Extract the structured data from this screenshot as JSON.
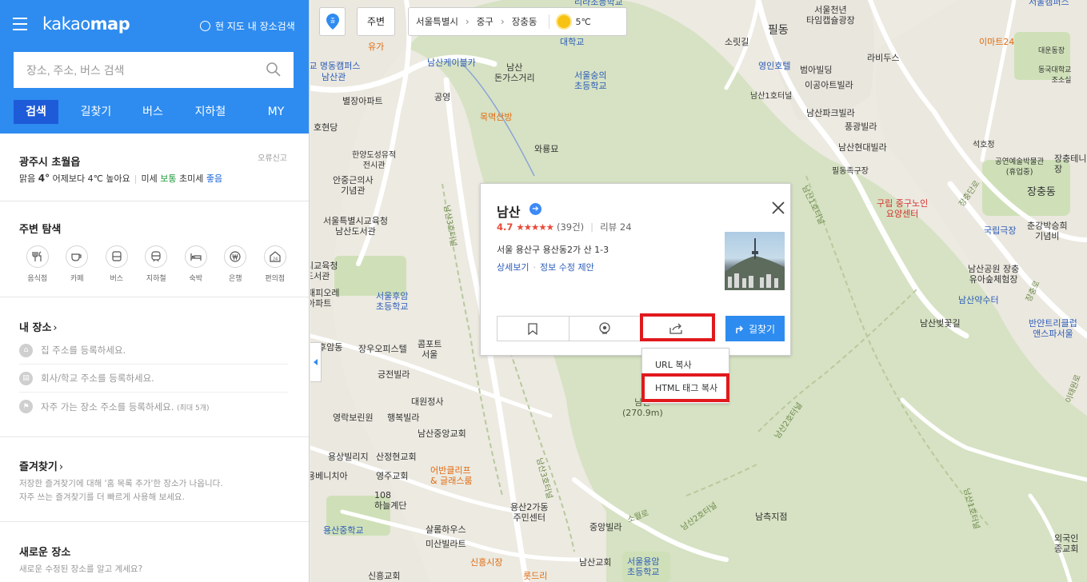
{
  "app": {
    "logo_light": "kakao",
    "logo_bold": "map",
    "here_search": "현 지도 내 장소검색"
  },
  "search": {
    "placeholder": "장소, 주소, 버스 검색"
  },
  "tabs": [
    "검색",
    "길찾기",
    "버스",
    "지하철",
    "MY"
  ],
  "weather": {
    "city": "광주시 초월읍",
    "report": "오류신고",
    "sky": "맑음",
    "temp": "4°",
    "compare": "어제보다 4℃ 높아요",
    "dust_label": "미세",
    "dust_value": "보통",
    "ultra_label": "초미세",
    "ultra_value": "좋음"
  },
  "explore": {
    "title": "주변 탐색",
    "categories": [
      "음식점",
      "카페",
      "버스",
      "지하철",
      "숙박",
      "은행",
      "편의점"
    ]
  },
  "myplace": {
    "title": "내 장소",
    "home": "집 주소를 등록하세요.",
    "work": "회사/학교 주소를 등록하세요.",
    "frequent": "자주 가는 장소 주소를 등록하세요.",
    "frequent_note": "(최대 5개)"
  },
  "favorites": {
    "title": "즐겨찾기",
    "desc1": "저장한 즐겨찾기에 대해 '홈 목록 추가'한 장소가 나옵니다.",
    "desc2": "자주 쓰는 즐겨찾기를 더 빠르게 사용해 보세요."
  },
  "newplace": {
    "title": "새로운 장소",
    "desc": "새로운 수정된 장소를 알고 계세요?"
  },
  "topbar": {
    "pin_label": "출",
    "around": "주변",
    "crumbs": [
      "서울특별시",
      "중구",
      "장충동"
    ],
    "temp": "5℃"
  },
  "card": {
    "title": "남산",
    "rating": "4.7",
    "stars": "★★★★★",
    "count": "(39건)",
    "reviews": "리뷰 24",
    "address": "서울 용산구 용산동2가 산 1-3",
    "detail_link": "상세보기",
    "edit_link": "정보 수정 제안",
    "route": "길찾기"
  },
  "share_menu": {
    "url": "URL 복사",
    "html": "HTML 태그 복사"
  },
  "map_labels": [
    "대학교 명동캠퍼스",
    "남산관",
    "유가",
    "남산케이블카",
    "별장아파트",
    "공영",
    "남산\n돈가스거리",
    "대학교",
    "리라초등학교",
    "서울숭의\n초등학교",
    "목멱산방",
    "와룡묘",
    "호현당",
    "한양도성유적\n전시관",
    "안중근의사\n기념관",
    "서울특별시교육청\n남산도서관",
    "시교육청\n도서관",
    "서울후암\n초등학교",
    "패피오레\n아파트",
    "후암동",
    "장우오피스텔",
    "콤포트\n서울",
    "긍전빌라",
    "대원정사",
    "영락보린원",
    "행복빌라",
    "남산중앙교회",
    "용상빌리지",
    "산정현교회",
    "어반클리프\n& 글래스룸",
    "용베니치아",
    "영주교회",
    "108\n하늘계단",
    "용산2가동\n주민센터",
    "용산중학교",
    "살롬하우스",
    "미산빌라트",
    "중앙빌라",
    "서울용암\n초등학교",
    "신흥시장",
    "신흥교회",
    "롯드리",
    "남산교회",
    "남산\n(270.9m)",
    "필동",
    "소릿길",
    "서울천년\n타임캡슐광장",
    "영인호텔",
    "범아빌딩",
    "라비두스",
    "남산1호터널",
    "이공아트빌라",
    "남산파크빌라",
    "풍광빌라",
    "남산현대빌라",
    "필동족구장",
    "구립 중구노인\n요양센터",
    "서울캠퍼스",
    "이마트24",
    "대운동장",
    "동국대학교\n조소실",
    "석호정",
    "공연예술박물관\n(휴업중)",
    "장충테니스\n장",
    "장충동",
    "국립극장",
    "춘강박승희\n기념비",
    "남산공원 장충\n유아숲체험장",
    "남산약수터",
    "남산벚꽃길",
    "반얀트리클럽\n앤스파서울",
    "남측지점",
    "외국인\n종교회",
    "이태원로",
    "남산3호터널",
    "남산3호터널",
    "남산1호터널",
    "남산2호터널",
    "남산2호터널",
    "남산1호터널",
    "장충단로",
    "장충로",
    "소월로"
  ],
  "colors": {
    "brand_blue": "#2e8cf0",
    "tab_active": "#1e5bd8",
    "highlight_red": "#e0191d",
    "rating_red": "#e94b3a"
  }
}
